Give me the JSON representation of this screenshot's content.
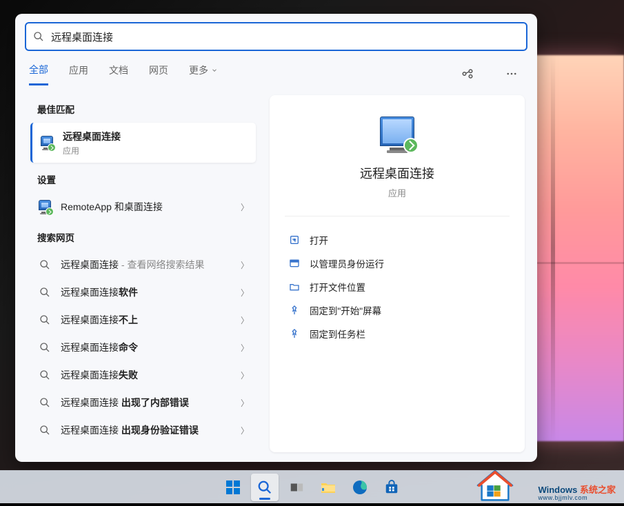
{
  "search": {
    "value": "远程桌面连接"
  },
  "tabs": {
    "all": "全部",
    "apps": "应用",
    "docs": "文档",
    "web": "网页",
    "more": "更多"
  },
  "sections": {
    "best": "最佳匹配",
    "settings": "设置",
    "web": "搜索网页"
  },
  "bestMatch": {
    "title": "远程桌面连接",
    "sub": "应用"
  },
  "settingsItems": [
    {
      "label": "RemoteApp 和桌面连接"
    }
  ],
  "webItems": [
    {
      "prefix": "远程桌面连接",
      "bold": "",
      "suffix": " - 查看网络搜索结果"
    },
    {
      "prefix": "远程桌面连接",
      "bold": "软件",
      "suffix": ""
    },
    {
      "prefix": "远程桌面连接",
      "bold": "不上",
      "suffix": ""
    },
    {
      "prefix": "远程桌面连接",
      "bold": "命令",
      "suffix": ""
    },
    {
      "prefix": "远程桌面连接",
      "bold": "失败",
      "suffix": ""
    },
    {
      "prefix": "远程桌面连接 ",
      "bold": "出现了内部错误",
      "suffix": ""
    },
    {
      "prefix": "远程桌面连接 ",
      "bold": "出现身份验证错误",
      "suffix": ""
    }
  ],
  "detail": {
    "title": "远程桌面连接",
    "sub": "应用"
  },
  "actions": {
    "open": "打开",
    "runadmin": "以管理员身份运行",
    "openloc": "打开文件位置",
    "pinstart": "固定到\"开始\"屏幕",
    "pintask": "固定到任务栏"
  },
  "watermark": {
    "brand1": "Windows ",
    "brand2": "系统之家",
    "url": "www.bjjmlv.com"
  }
}
